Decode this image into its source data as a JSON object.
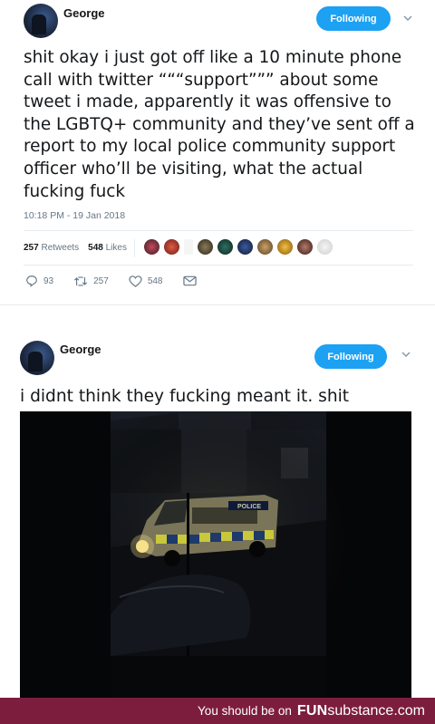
{
  "tweets": [
    {
      "author": "George",
      "follow_label": "Following",
      "text": "shit okay i just got off like a 10 minute phone call with twitter “““support””” about some tweet i made, apparently it was offensive to the LGBTQ+ community and they’ve sent off a report to my local police community support officer who’ll be visiting, what the actual fucking fuck",
      "timestamp": "10:18 PM - 19 Jan 2018",
      "retweets_count": "257",
      "retweets_label": "Retweets",
      "likes_count": "548",
      "likes_label": "Likes",
      "reply_count": "93",
      "retweet_action_count": "257",
      "like_action_count": "548"
    },
    {
      "author": "George",
      "follow_label": "Following",
      "text": "i didnt think they fucking meant it. shit"
    }
  ],
  "video": {
    "vehicle_label": "POLICE"
  },
  "footer": {
    "prefix": "You should be on",
    "brand_bold": "FUN",
    "brand_rest": "substance.com"
  },
  "colors": {
    "accent": "#1da1f2",
    "footer_bg": "#7c1d3e",
    "muted": "#657786"
  }
}
